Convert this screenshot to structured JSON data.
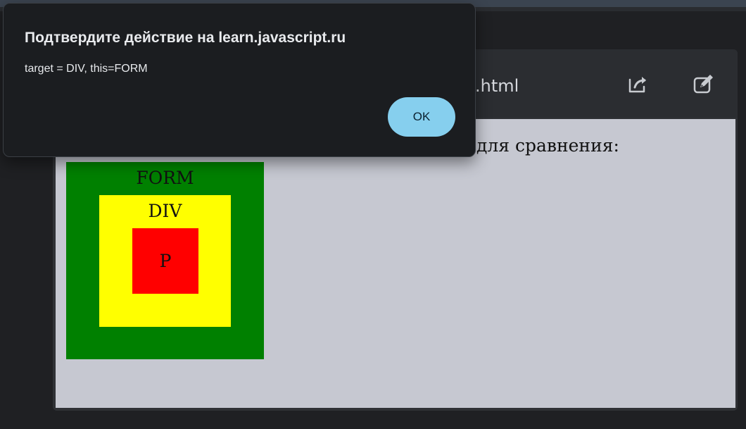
{
  "dialog": {
    "title": "Подтвердите действие на learn.javascript.ru",
    "message": "target = DIV, this=FORM",
    "ok_label": "OK"
  },
  "example": {
    "file_name": ".html",
    "share_icon": "share-icon",
    "edit_icon": "edit-icon",
    "compare_text": "для сравнения:"
  },
  "demo": {
    "form_label": "FORM",
    "div_label": "DIV",
    "p_label": "P"
  },
  "colors": {
    "form": "#008000",
    "div": "#ffff00",
    "p": "#ff0000",
    "ok_button": "#86cfee",
    "preview_background": "#c6c8d1"
  }
}
